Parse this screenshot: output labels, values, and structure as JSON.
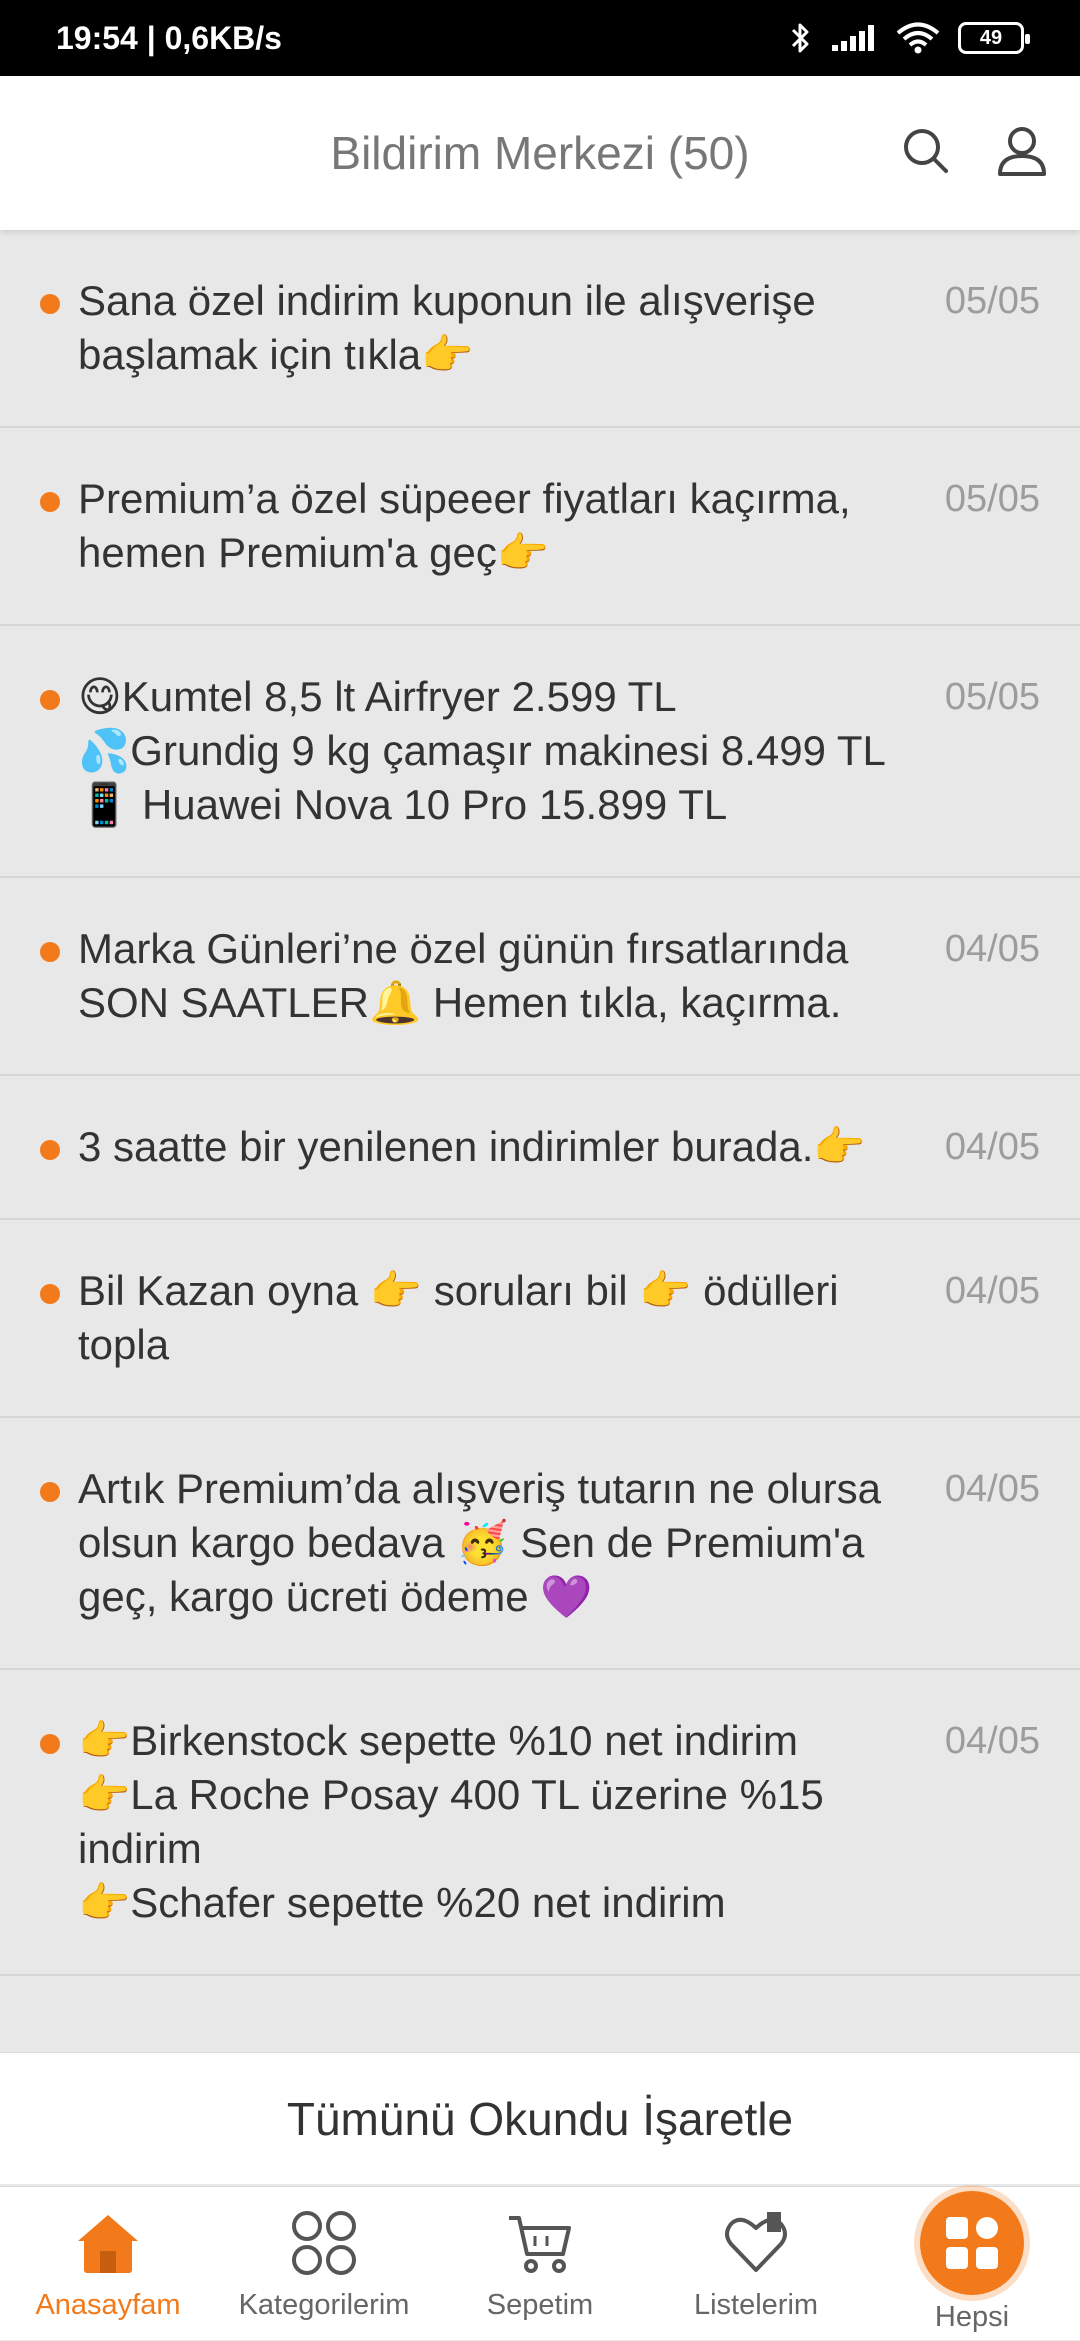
{
  "status_bar": {
    "time_speed": "19:54 | 0,6KB/s",
    "battery": "49",
    "icons": [
      "bluetooth-icon",
      "signal-icon",
      "wifi-icon",
      "battery-icon"
    ]
  },
  "header": {
    "title": "Bildirim Merkezi (50)",
    "icons": [
      "search-icon",
      "profile-icon"
    ]
  },
  "notifications": [
    {
      "text": "Sana özel indirim kuponun ile alışverişe başlamak için tıkla👉",
      "date": "05/05"
    },
    {
      "text": "Premium’a özel süpeeer fiyatları kaçırma, hemen Premium'a geç👉",
      "date": "05/05"
    },
    {
      "text": "😋Kumtel 8,5 lt Airfryer 2.599 TL\n💦Grundig 9 kg çamaşır makinesi 8.499 TL\n📱 Huawei Nova 10 Pro 15.899 TL",
      "date": "05/05"
    },
    {
      "text": "Marka Günleri’ne özel günün fırsatlarında SON SAATLER🔔 Hemen tıkla, kaçırma.",
      "date": "04/05"
    },
    {
      "text": "3 saatte bir yenilenen indirimler burada.👉",
      "date": "04/05"
    },
    {
      "text": "Bil Kazan oyna 👉 soruları bil 👉 ödülleri topla",
      "date": "04/05"
    },
    {
      "text": "Artık Premium’da alışveriş tutarın ne olursa olsun kargo bedava 🥳 Sen de Premium'a geç, kargo ücreti ödeme 💜",
      "date": "04/05"
    },
    {
      "text": "👉Birkenstock sepette %10 net indirim\n👉La Roche Posay 400 TL üzerine %15 indirim\n👉Schafer sepette %20 net indirim",
      "date": "04/05"
    }
  ],
  "mark_all_read": "Tümünü Okundu İşaretle",
  "bottom_nav": [
    {
      "label": "Anasayfam",
      "icon": "home-icon",
      "active": true
    },
    {
      "label": "Kategorilerim",
      "icon": "categories-icon",
      "active": false
    },
    {
      "label": "Sepetim",
      "icon": "cart-icon",
      "active": false
    },
    {
      "label": "Listelerim",
      "icon": "heart-list-icon",
      "active": false
    },
    {
      "label": "Hepsi",
      "icon": "all-grid-icon",
      "active": false
    }
  ],
  "colors": {
    "accent": "#f27a1a",
    "list_bg": "#e8e8e8",
    "header_bg": "#ffffff"
  }
}
